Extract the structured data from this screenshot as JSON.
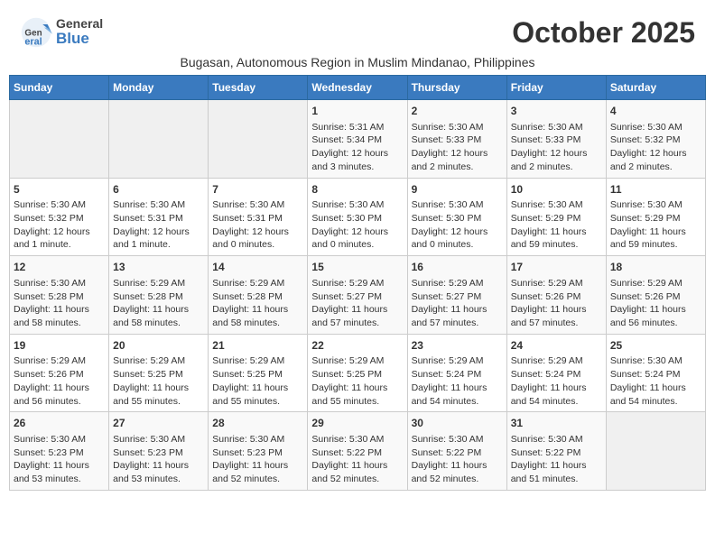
{
  "header": {
    "logo_general": "General",
    "logo_blue": "Blue",
    "month_title": "October 2025",
    "subtitle": "Bugasan, Autonomous Region in Muslim Mindanao, Philippines"
  },
  "days_of_week": [
    "Sunday",
    "Monday",
    "Tuesday",
    "Wednesday",
    "Thursday",
    "Friday",
    "Saturday"
  ],
  "weeks": [
    [
      {
        "day": "",
        "info": ""
      },
      {
        "day": "",
        "info": ""
      },
      {
        "day": "",
        "info": ""
      },
      {
        "day": "1",
        "info": "Sunrise: 5:31 AM\nSunset: 5:34 PM\nDaylight: 12 hours and 3 minutes."
      },
      {
        "day": "2",
        "info": "Sunrise: 5:30 AM\nSunset: 5:33 PM\nDaylight: 12 hours and 2 minutes."
      },
      {
        "day": "3",
        "info": "Sunrise: 5:30 AM\nSunset: 5:33 PM\nDaylight: 12 hours and 2 minutes."
      },
      {
        "day": "4",
        "info": "Sunrise: 5:30 AM\nSunset: 5:32 PM\nDaylight: 12 hours and 2 minutes."
      }
    ],
    [
      {
        "day": "5",
        "info": "Sunrise: 5:30 AM\nSunset: 5:32 PM\nDaylight: 12 hours and 1 minute."
      },
      {
        "day": "6",
        "info": "Sunrise: 5:30 AM\nSunset: 5:31 PM\nDaylight: 12 hours and 1 minute."
      },
      {
        "day": "7",
        "info": "Sunrise: 5:30 AM\nSunset: 5:31 PM\nDaylight: 12 hours and 0 minutes."
      },
      {
        "day": "8",
        "info": "Sunrise: 5:30 AM\nSunset: 5:30 PM\nDaylight: 12 hours and 0 minutes."
      },
      {
        "day": "9",
        "info": "Sunrise: 5:30 AM\nSunset: 5:30 PM\nDaylight: 12 hours and 0 minutes."
      },
      {
        "day": "10",
        "info": "Sunrise: 5:30 AM\nSunset: 5:29 PM\nDaylight: 11 hours and 59 minutes."
      },
      {
        "day": "11",
        "info": "Sunrise: 5:30 AM\nSunset: 5:29 PM\nDaylight: 11 hours and 59 minutes."
      }
    ],
    [
      {
        "day": "12",
        "info": "Sunrise: 5:30 AM\nSunset: 5:28 PM\nDaylight: 11 hours and 58 minutes."
      },
      {
        "day": "13",
        "info": "Sunrise: 5:29 AM\nSunset: 5:28 PM\nDaylight: 11 hours and 58 minutes."
      },
      {
        "day": "14",
        "info": "Sunrise: 5:29 AM\nSunset: 5:28 PM\nDaylight: 11 hours and 58 minutes."
      },
      {
        "day": "15",
        "info": "Sunrise: 5:29 AM\nSunset: 5:27 PM\nDaylight: 11 hours and 57 minutes."
      },
      {
        "day": "16",
        "info": "Sunrise: 5:29 AM\nSunset: 5:27 PM\nDaylight: 11 hours and 57 minutes."
      },
      {
        "day": "17",
        "info": "Sunrise: 5:29 AM\nSunset: 5:26 PM\nDaylight: 11 hours and 57 minutes."
      },
      {
        "day": "18",
        "info": "Sunrise: 5:29 AM\nSunset: 5:26 PM\nDaylight: 11 hours and 56 minutes."
      }
    ],
    [
      {
        "day": "19",
        "info": "Sunrise: 5:29 AM\nSunset: 5:26 PM\nDaylight: 11 hours and 56 minutes."
      },
      {
        "day": "20",
        "info": "Sunrise: 5:29 AM\nSunset: 5:25 PM\nDaylight: 11 hours and 55 minutes."
      },
      {
        "day": "21",
        "info": "Sunrise: 5:29 AM\nSunset: 5:25 PM\nDaylight: 11 hours and 55 minutes."
      },
      {
        "day": "22",
        "info": "Sunrise: 5:29 AM\nSunset: 5:25 PM\nDaylight: 11 hours and 55 minutes."
      },
      {
        "day": "23",
        "info": "Sunrise: 5:29 AM\nSunset: 5:24 PM\nDaylight: 11 hours and 54 minutes."
      },
      {
        "day": "24",
        "info": "Sunrise: 5:29 AM\nSunset: 5:24 PM\nDaylight: 11 hours and 54 minutes."
      },
      {
        "day": "25",
        "info": "Sunrise: 5:30 AM\nSunset: 5:24 PM\nDaylight: 11 hours and 54 minutes."
      }
    ],
    [
      {
        "day": "26",
        "info": "Sunrise: 5:30 AM\nSunset: 5:23 PM\nDaylight: 11 hours and 53 minutes."
      },
      {
        "day": "27",
        "info": "Sunrise: 5:30 AM\nSunset: 5:23 PM\nDaylight: 11 hours and 53 minutes."
      },
      {
        "day": "28",
        "info": "Sunrise: 5:30 AM\nSunset: 5:23 PM\nDaylight: 11 hours and 52 minutes."
      },
      {
        "day": "29",
        "info": "Sunrise: 5:30 AM\nSunset: 5:22 PM\nDaylight: 11 hours and 52 minutes."
      },
      {
        "day": "30",
        "info": "Sunrise: 5:30 AM\nSunset: 5:22 PM\nDaylight: 11 hours and 52 minutes."
      },
      {
        "day": "31",
        "info": "Sunrise: 5:30 AM\nSunset: 5:22 PM\nDaylight: 11 hours and 51 minutes."
      },
      {
        "day": "",
        "info": ""
      }
    ]
  ]
}
